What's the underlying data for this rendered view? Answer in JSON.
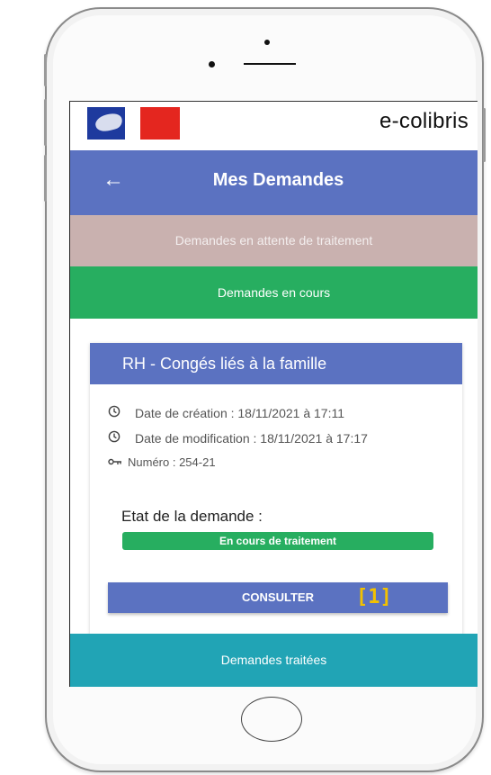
{
  "brand": {
    "name": "e-colibris",
    "flag_colors": [
      "#1e3a9e",
      "#ffffff",
      "#e4261f"
    ]
  },
  "header": {
    "back_icon": "arrow-left-icon",
    "back_glyph": "←",
    "title": "Mes Demandes",
    "color": "#5b72c1"
  },
  "sections": {
    "pending": "Demandes en attente de traitement",
    "in_progress": "Demandes en cours",
    "done": "Demandes traitées"
  },
  "request": {
    "title": "RH - Congés liés à la famille",
    "created": "Date de création : 18/11/2021 à 17:11",
    "modified": "Date de modification : 18/11/2021 à 17:17",
    "number": "Numéro : 254-21",
    "state_label": "Etat de la demande :",
    "state_value": "En cours de traitement",
    "state_color": "#27ae60",
    "action_label": "CONSULTER",
    "marker": "[1]"
  },
  "icons": {
    "clock": "clock-icon",
    "key": "key-icon"
  }
}
